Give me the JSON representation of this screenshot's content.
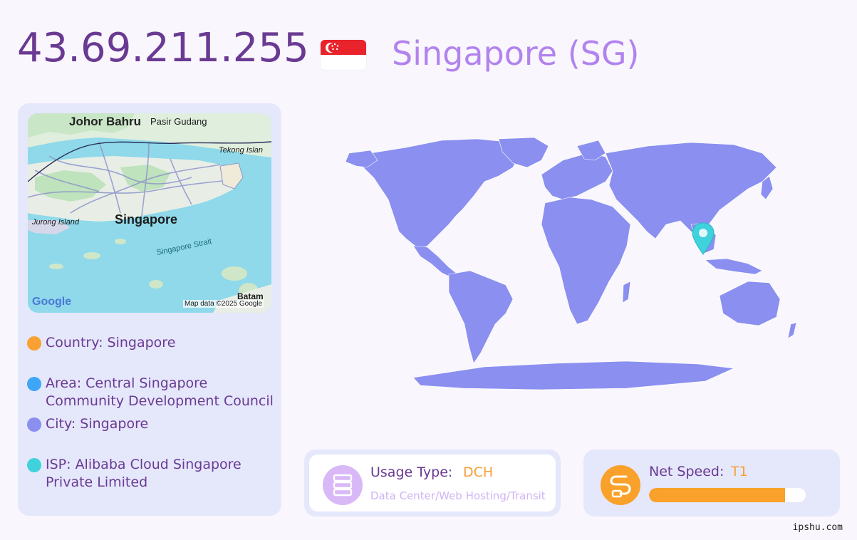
{
  "header": {
    "ip": "43.69.211.255",
    "country_title": "Singapore (SG)",
    "flag_icon": "singapore-flag-icon"
  },
  "minimap": {
    "labels": {
      "johor_bahru": "Johor Bahru",
      "pasir_gudang": "Pasir Gudang",
      "tekong": "Tekong Islan",
      "jurong": "Jurong Island",
      "singapore": "Singapore",
      "strait": "Singapore Strait",
      "batam": "Batam",
      "google": "Google",
      "attribution": "Map data ©2025 Google"
    }
  },
  "info": {
    "country": "Country: Singapore",
    "area": "Area: Central Singapore Community Development Council",
    "city": "City: Singapore",
    "isp": "ISP: Alibaba Cloud Singapore Private Limited"
  },
  "usage": {
    "label": "Usage Type:",
    "value": "DCH",
    "description": "Data Center/Web Hosting/Transit",
    "icon": "server-icon"
  },
  "speed": {
    "label": "Net Speed:",
    "value": "T1",
    "level": 0.87,
    "icon": "speed-icon"
  },
  "colors": {
    "ip": "#6a3a93",
    "country_title": "#b283ee",
    "dot_country": "#f8a132",
    "dot_area": "#3ea6f7",
    "dot_city": "#8a8ff0",
    "dot_isp": "#3fd2dd",
    "land": "#8a8ff0",
    "marker": "#3fd2dd",
    "accent_orange": "#f9a12a"
  },
  "watermark": "ipshu.com"
}
